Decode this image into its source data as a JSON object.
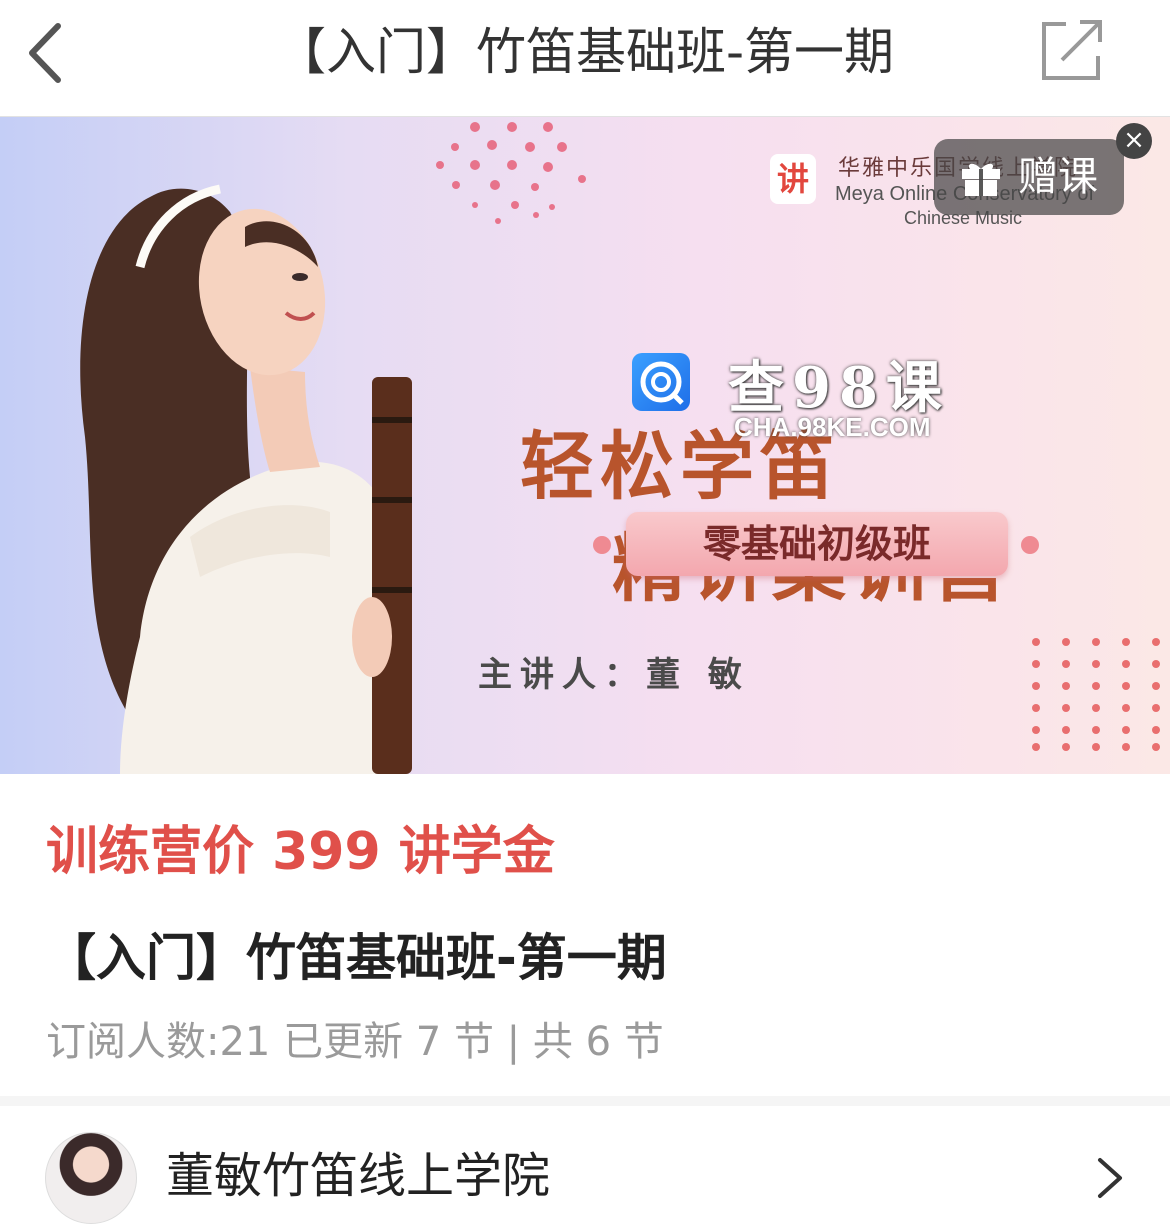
{
  "nav": {
    "title": "【入门】竹笛基础班-第一期",
    "back_icon": "chevron-left-icon",
    "share_icon": "share-external-icon"
  },
  "banner": {
    "headline_line1": "轻松学笛",
    "headline_line2": "精讲集训营",
    "class_label": "零基础初级班",
    "lecturer": "主讲人：董 敏",
    "org_badge": "讲",
    "org_name_cn": "华雅中乐国学线上学院",
    "org_name_en_line1": "Meya Online Conservatory of",
    "org_name_en_line2": "Chinese Music",
    "gift_button_label": "赠课",
    "gift_close": "×",
    "watermark_cn": "查98课",
    "watermark_en": "CHA.98KE.COM"
  },
  "price": {
    "label": "训练营价 399 讲学金"
  },
  "course": {
    "title": "【入门】竹笛基础班-第一期",
    "meta": "订阅人数:21 已更新 7 节 | 共 6 节"
  },
  "author": {
    "name": "董敏竹笛线上学院",
    "chevron_icon": "chevron-right-icon"
  },
  "colors": {
    "accent_red": "#e0504a",
    "headline_brown": "#b8542c",
    "meta_gray": "#9a9a9a"
  }
}
